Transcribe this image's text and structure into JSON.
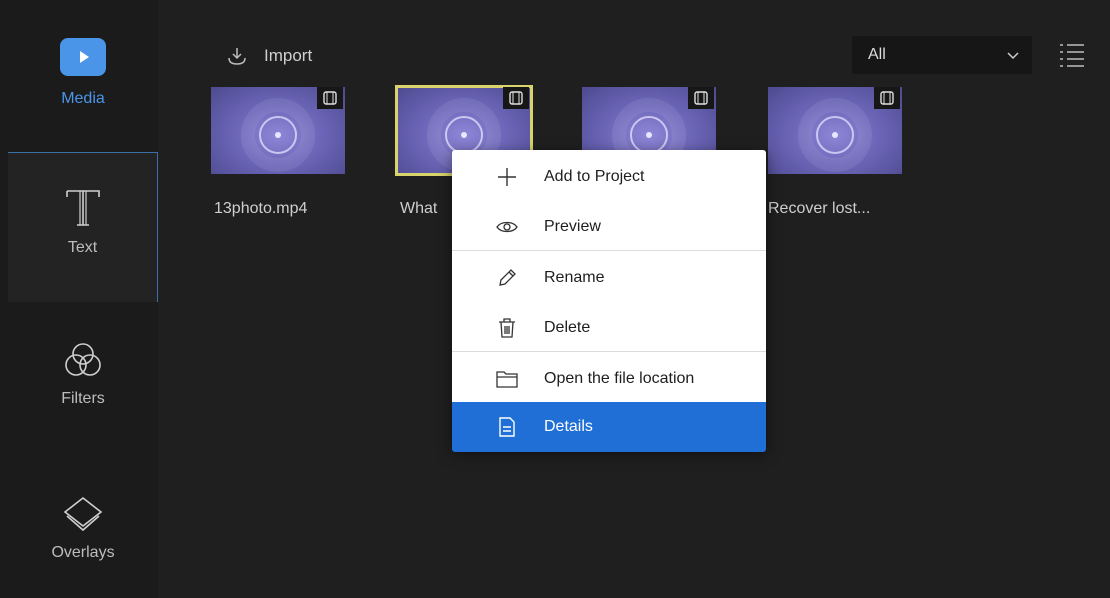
{
  "sidebar": {
    "items": [
      {
        "label": "Media",
        "icon": "play-icon"
      },
      {
        "label": "Text",
        "icon": "text-icon"
      },
      {
        "label": "Filters",
        "icon": "filters-icon"
      },
      {
        "label": "Overlays",
        "icon": "overlays-icon"
      }
    ]
  },
  "toolbar": {
    "import_label": "Import",
    "filter_value": "All"
  },
  "media": {
    "items": [
      {
        "name": "13photo.mp4"
      },
      {
        "name": "What"
      },
      {
        "name": ""
      },
      {
        "name": "Recover lost..."
      }
    ]
  },
  "context_menu": {
    "items": [
      {
        "label": "Add to Project",
        "icon": "plus-icon"
      },
      {
        "label": "Preview",
        "icon": "eye-icon"
      },
      {
        "label": "Rename",
        "icon": "pencil-icon"
      },
      {
        "label": "Delete",
        "icon": "trash-icon"
      },
      {
        "label": "Open the file location",
        "icon": "folder-icon"
      },
      {
        "label": "Details",
        "icon": "document-icon"
      }
    ]
  },
  "colors": {
    "accent": "#4a95e8",
    "menu_highlight": "#1f6fd6",
    "selection_outline": "#d8d36a"
  }
}
